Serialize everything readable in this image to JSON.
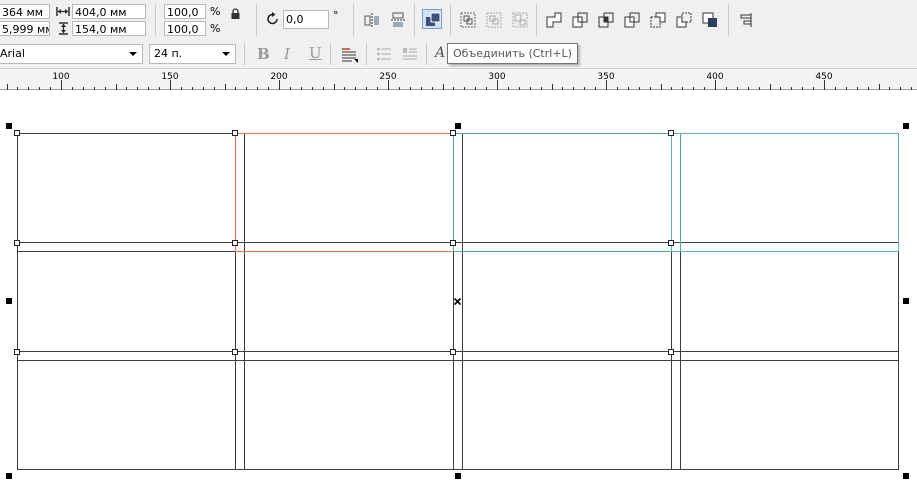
{
  "toolbar_top": {
    "pos_x": "364 мм",
    "pos_y": "5,999 мм",
    "width": "404,0 мм",
    "height": "154,0 мм",
    "scale_x": "100,0",
    "scale_y": "100,0",
    "percent_sign": "%",
    "rotation": "0,0",
    "degree_sign": "°"
  },
  "toolbar_text": {
    "font_family": "Arial",
    "font_size": "24 п.",
    "bold_glyph": "B",
    "italic_glyph": "I",
    "underline_glyph": "U"
  },
  "tooltip": {
    "text": "Объединить (Ctrl+L)"
  },
  "ruler": {
    "labels": [
      "100",
      "150",
      "200",
      "250",
      "300",
      "350",
      "400",
      "450"
    ]
  },
  "colors": {
    "outline_dark": "#3c3c3c",
    "outline_orange": "#e8784c",
    "outline_green": "#4caf7f",
    "outline_blue": "#5ab3d6",
    "active_button_bg": "#cfe0f5"
  },
  "icons": [
    "lock-icon",
    "rotate-icon",
    "mirror-horizontal-icon",
    "mirror-vertical-icon",
    "combine-icon",
    "group-icon",
    "ungroup-icon",
    "ungroup-all-icon",
    "weld-icon",
    "trim-icon",
    "intersect-icon",
    "simplify-icon",
    "front-minus-back-icon",
    "back-minus-front-icon",
    "boundary-icon",
    "align-icon",
    "text-align-icon",
    "bullets-icon",
    "indent-icon",
    "text-tool-icon"
  ]
}
